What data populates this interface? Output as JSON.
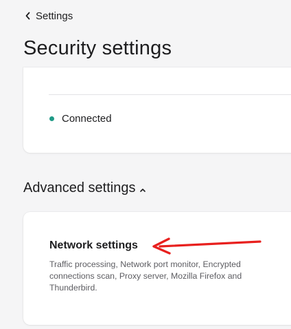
{
  "header": {
    "back_label": "Settings",
    "page_title": "Security settings"
  },
  "connection_card": {
    "status_text": "Connected",
    "status_color": "#1f9a86"
  },
  "advanced": {
    "heading": "Advanced settings",
    "expanded": true
  },
  "network_card": {
    "title": "Network settings",
    "description": "Traffic processing, Network port monitor, Encrypted connections scan, Proxy server, Mozilla Firefox and Thunderbird."
  },
  "annotation": {
    "arrow_color": "#e8201e"
  },
  "icons": {
    "back": "chevron-left-icon",
    "collapse": "chevron-up-icon",
    "status": "status-dot"
  }
}
